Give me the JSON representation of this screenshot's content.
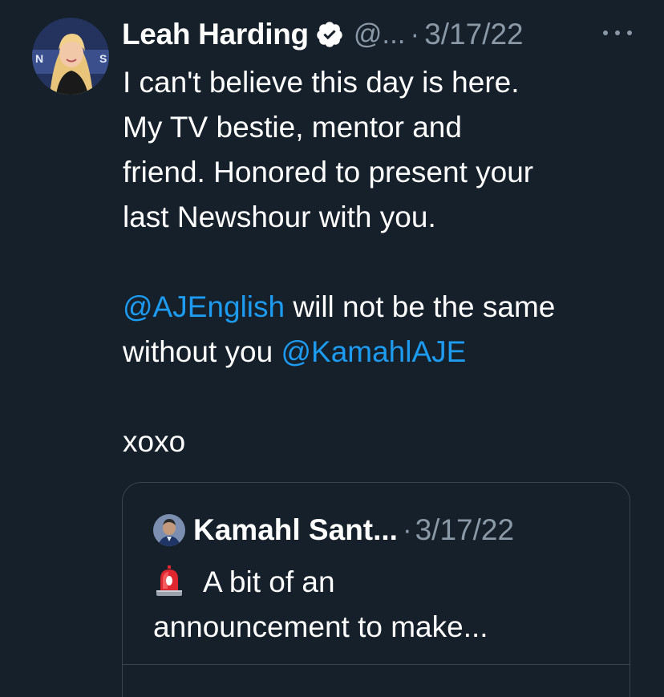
{
  "tweet": {
    "author_name": "Leah Harding",
    "handle": "@...",
    "separator": "·",
    "date": "3/17/22",
    "body_lines": [
      "I can't believe this day is here.",
      "My TV bestie, mentor and",
      "friend. Honored to present your",
      "last Newshour with you."
    ],
    "mention_1": "@AJEnglish",
    "line5_rest": " will not be the same",
    "line6_start": "without you ",
    "mention_2": "@KamahlAJE",
    "signoff": "xoxo",
    "more_icon": "more-horizontal-icon",
    "verified_icon": "verified-badge-icon"
  },
  "quoted_tweet": {
    "author_name": "Kamahl Sant...",
    "separator": "·",
    "date": "3/17/22",
    "emoji_icon": "rotating-light-icon",
    "body_line_1": "A bit of an",
    "body_line_2": "announcement to make..."
  },
  "colors": {
    "background": "#15202b",
    "text": "#ffffff",
    "secondary": "#8b98a5",
    "link": "#1d9bf0",
    "border": "#38444d"
  }
}
